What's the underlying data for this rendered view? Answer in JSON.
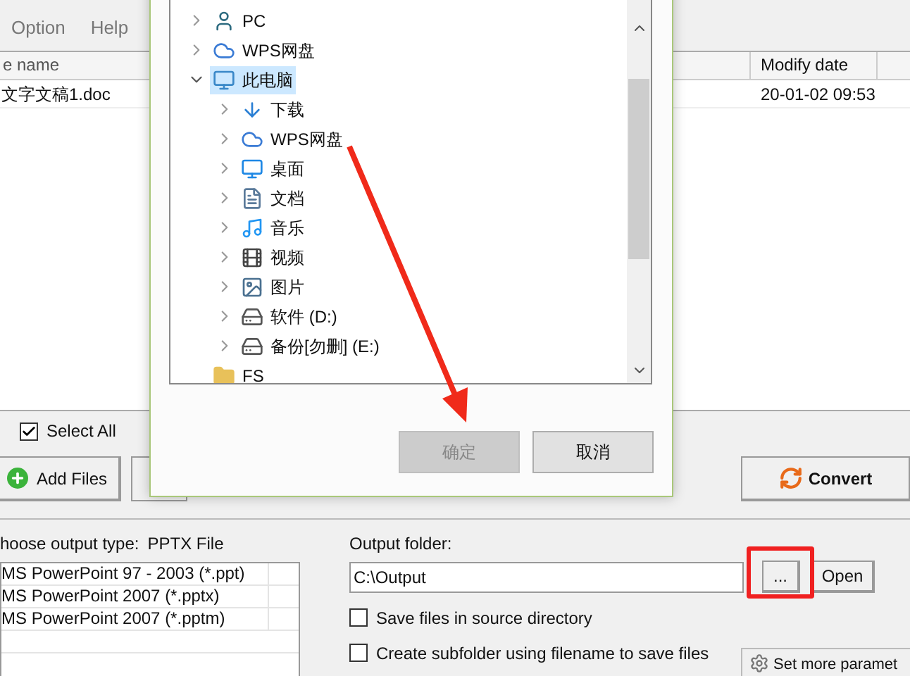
{
  "menu": [
    {
      "label": "Option"
    },
    {
      "label": "Help"
    }
  ],
  "file_table": {
    "columns": [
      "e name",
      "Modify date"
    ],
    "rows": [
      [
        "文字文稿1.doc",
        "20-01-02 09:53"
      ]
    ]
  },
  "select_all": {
    "label": "Select All",
    "checked": true
  },
  "add_files": "Add Files",
  "convert": "Convert",
  "output_type": {
    "label": "hoose output type:",
    "value": "PPTX File",
    "options": [
      "MS PowerPoint 97 - 2003 (*.ppt)",
      "MS PowerPoint 2007 (*.pptx)",
      "MS PowerPoint 2007 (*.pptm)"
    ]
  },
  "output_folder": {
    "label": "Output folder:",
    "value": "C:\\Output",
    "browse": "...",
    "open": "Open"
  },
  "options": [
    {
      "label": "Save files in source directory",
      "checked": false
    },
    {
      "label": "Create subfolder using filename to save files",
      "checked": false
    }
  ],
  "more_params": "Set more paramet",
  "dialog": {
    "tree": [
      {
        "label": "PC",
        "kind": "user",
        "expanded": false,
        "selected": false
      },
      {
        "label": "WPS网盘",
        "kind": "cloud",
        "expanded": false,
        "selected": false
      },
      {
        "label": "此电脑",
        "kind": "computer",
        "expanded": true,
        "selected": true,
        "children": [
          {
            "label": "下载",
            "kind": "download",
            "expanded": false,
            "selected": false
          },
          {
            "label": "WPS网盘",
            "kind": "cloud",
            "expanded": false,
            "selected": false
          },
          {
            "label": "桌面",
            "kind": "desktop",
            "expanded": false,
            "selected": false
          },
          {
            "label": "文档",
            "kind": "document",
            "expanded": false,
            "selected": false
          },
          {
            "label": "音乐",
            "kind": "music",
            "expanded": false,
            "selected": false
          },
          {
            "label": "视频",
            "kind": "video",
            "expanded": false,
            "selected": false
          },
          {
            "label": "图片",
            "kind": "picture",
            "expanded": false,
            "selected": false
          },
          {
            "label": "软件 (D:)",
            "kind": "drive",
            "expanded": false,
            "selected": false
          },
          {
            "label": "备份[勿删] (E:)",
            "kind": "drive",
            "expanded": false,
            "selected": false
          }
        ]
      },
      {
        "label": "FS",
        "kind": "folder",
        "selected": false
      }
    ],
    "ok": {
      "label": "确定",
      "disabled": true
    },
    "cancel": {
      "label": "取消",
      "disabled": false
    }
  }
}
